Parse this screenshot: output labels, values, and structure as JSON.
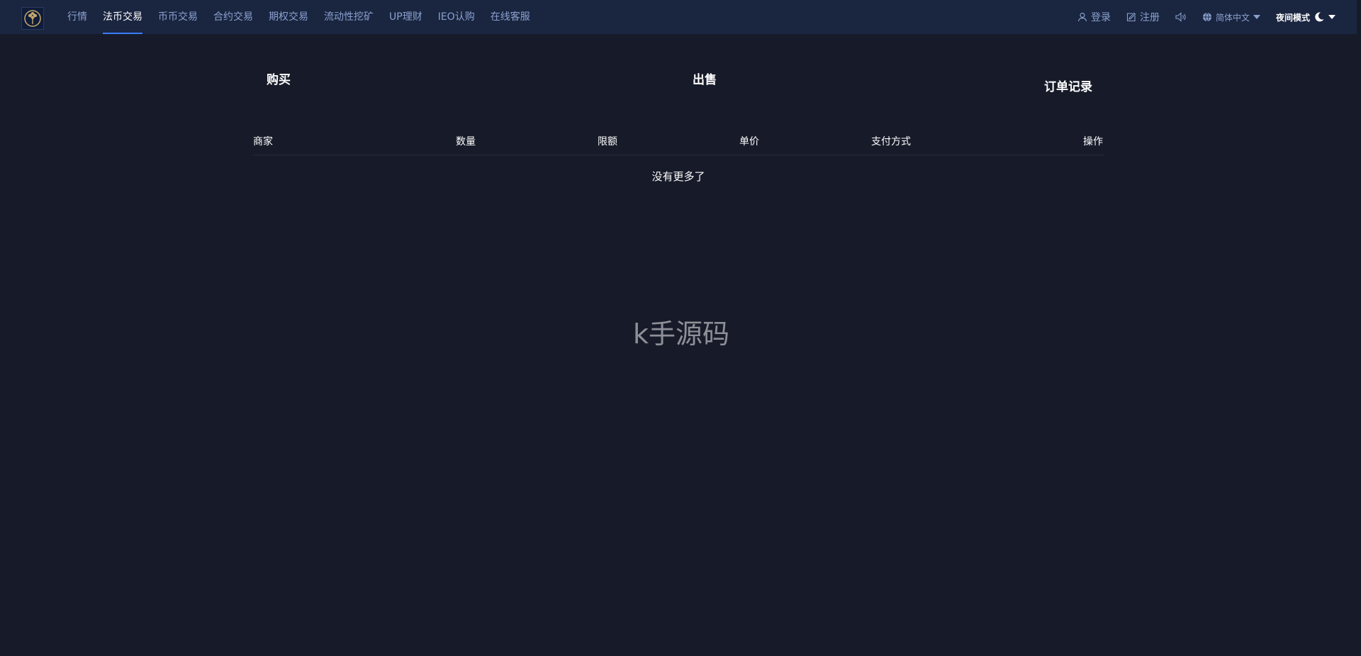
{
  "header": {
    "logo_icon": "tree-emblem-icon",
    "nav": [
      {
        "label": "行情",
        "active": false
      },
      {
        "label": "法币交易",
        "active": true
      },
      {
        "label": "币币交易",
        "active": false
      },
      {
        "label": "合约交易",
        "active": false
      },
      {
        "label": "期权交易",
        "active": false
      },
      {
        "label": "流动性挖矿",
        "active": false
      },
      {
        "label": "UP理财",
        "active": false
      },
      {
        "label": "IEO认购",
        "active": false
      },
      {
        "label": "在线客服",
        "active": false
      }
    ],
    "login_label": "登录",
    "register_label": "注册",
    "language_label": "简体中文",
    "theme_label": "夜间模式",
    "icons": {
      "login": "user-icon",
      "register": "edit-icon",
      "sound": "speaker-icon",
      "language": "globe-icon",
      "theme": "moon-icon",
      "dropdown": "caret-down-icon"
    }
  },
  "tabs": {
    "buy": "购买",
    "sell": "出售",
    "orders": "订单记录"
  },
  "table": {
    "columns": [
      "商家",
      "数量",
      "限额",
      "单价",
      "支付方式",
      "操作"
    ],
    "empty_text": "没有更多了"
  },
  "watermark": "k手源码",
  "colors": {
    "background": "#171b29",
    "topbar": "#1a2540",
    "nav_text": "#8aa1cf",
    "accent": "#3b7cff"
  }
}
